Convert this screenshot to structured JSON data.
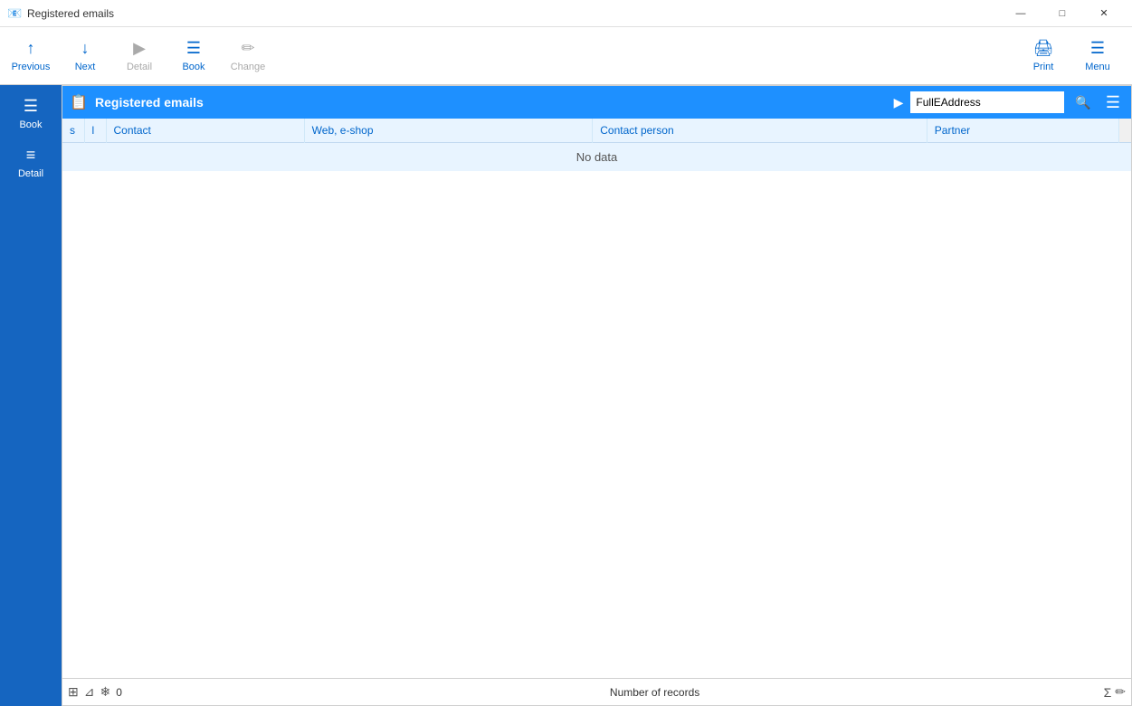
{
  "titleBar": {
    "icon": "📧",
    "title": "Registered emails",
    "minimizeBtn": "—",
    "maximizeBtn": "□",
    "closeBtn": "✕"
  },
  "toolbar": {
    "previousBtn": "Previous",
    "nextBtn": "Next",
    "detailBtn": "Detail",
    "bookBtn": "Book",
    "changeBtn": "Change",
    "printBtn": "Print",
    "menuBtn": "Menu"
  },
  "sidebar": {
    "bookBtn": "Book",
    "detailBtn": "Detail"
  },
  "listHeader": {
    "title": "Registered emails",
    "searchPlaceholder": "FullEAddress"
  },
  "table": {
    "columns": [
      "s",
      "l",
      "Contact",
      "Web, e-shop",
      "Contact person",
      "Partner"
    ],
    "noDataText": "No data"
  },
  "statusBar": {
    "recordCount": "0",
    "numberOfRecordsLabel": "Number of records"
  }
}
